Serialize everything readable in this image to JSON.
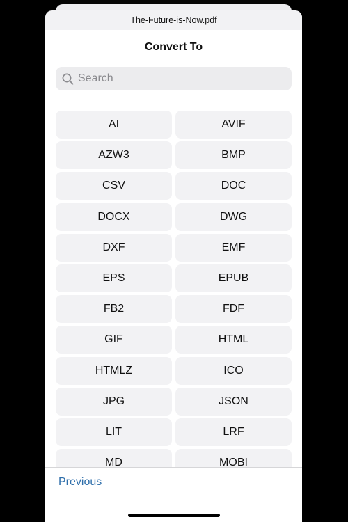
{
  "sheet": {
    "file_name": "The-Future-is-Now.pdf",
    "title": "Convert To"
  },
  "search": {
    "placeholder": "Search",
    "value": ""
  },
  "formats": [
    "AI",
    "AVIF",
    "AZW3",
    "BMP",
    "CSV",
    "DOC",
    "DOCX",
    "DWG",
    "DXF",
    "EMF",
    "EPS",
    "EPUB",
    "FB2",
    "FDF",
    "GIF",
    "HTML",
    "HTMLZ",
    "ICO",
    "JPG",
    "JSON",
    "LIT",
    "LRF",
    "MD",
    "MOBI"
  ],
  "footer": {
    "previous_label": "Previous"
  },
  "colors": {
    "link": "#2f6fab",
    "button_bg": "#f2f2f4",
    "search_bg": "#ececee"
  },
  "icons": {
    "search": "magnifying-glass"
  }
}
